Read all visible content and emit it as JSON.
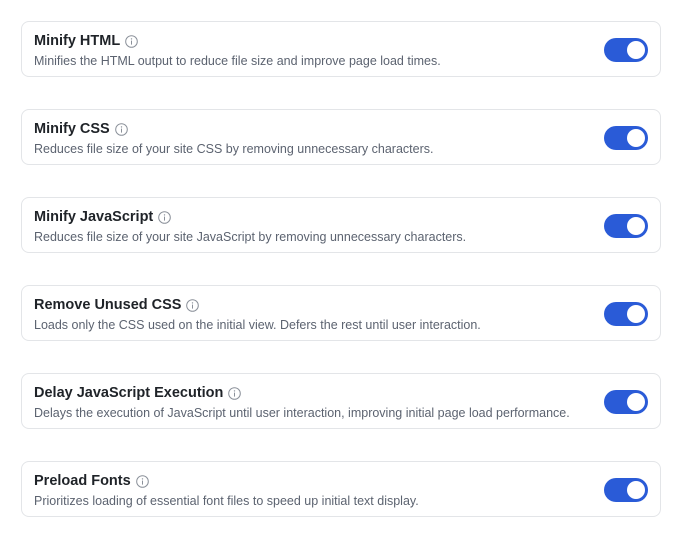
{
  "accent_color": "#2a5bd7",
  "settings": [
    {
      "title": "Minify HTML",
      "description": "Minifies the HTML output to reduce file size and improve page load times.",
      "enabled": true
    },
    {
      "title": "Minify CSS",
      "description": "Reduces file size of your site CSS by removing unnecessary characters.",
      "enabled": true
    },
    {
      "title": "Minify JavaScript",
      "description": "Reduces file size of your site JavaScript by removing unnecessary characters.",
      "enabled": true
    },
    {
      "title": "Remove Unused CSS",
      "description": "Loads only the CSS used on the initial view. Defers the rest until user interaction.",
      "enabled": true
    },
    {
      "title": "Delay JavaScript Execution",
      "description": "Delays the execution of JavaScript until user interaction, improving initial page load performance.",
      "enabled": true
    },
    {
      "title": "Preload Fonts",
      "description": "Prioritizes loading of essential font files to speed up initial text display.",
      "enabled": true
    }
  ],
  "icons": {
    "info": "info-icon"
  }
}
